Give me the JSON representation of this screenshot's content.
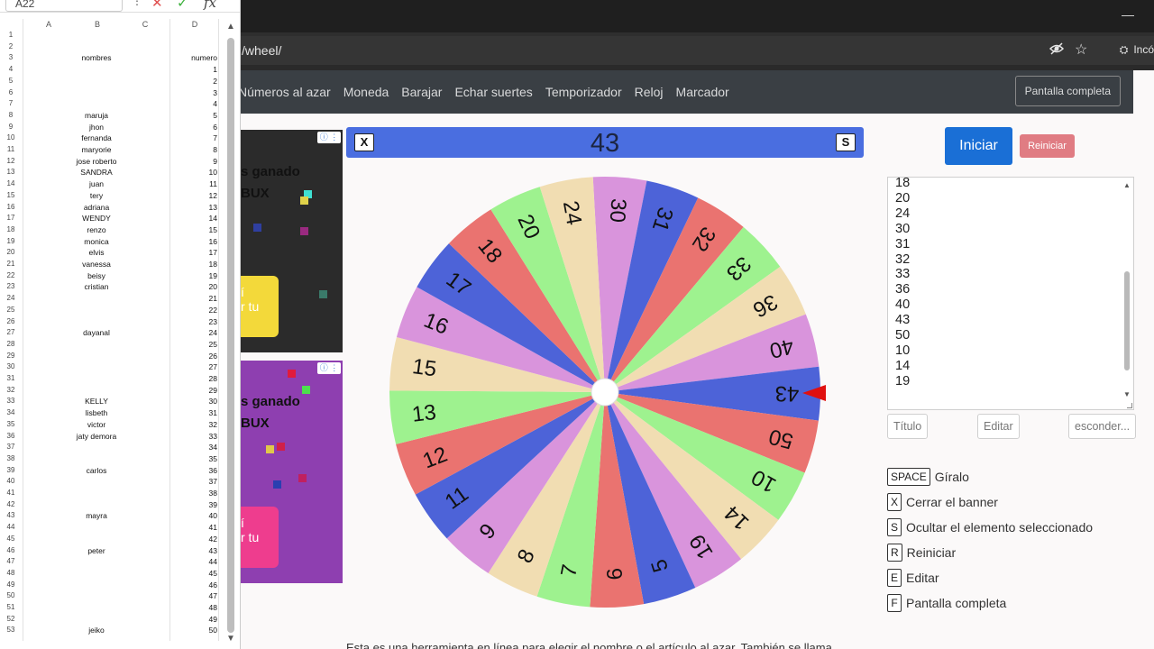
{
  "browser": {
    "url": "/wheel/",
    "incognito_label": "Incó",
    "minimize": "—"
  },
  "nav": {
    "links": [
      "Números al azar",
      "Moneda",
      "Barajar",
      "Echar suertes",
      "Temporizador",
      "Reloj",
      "Marcador"
    ],
    "fullscreen": "Pantalla completa"
  },
  "ads": {
    "ad1": {
      "line1": "s ganado",
      "line2": "BUX",
      "cta1": "í",
      "cta2": "r tu"
    },
    "ad2": {
      "line1": "s ganado",
      "line2": "BUX",
      "cta1": "í",
      "cta2": "r tu"
    },
    "info": "ⓘ ⋮"
  },
  "titlebar": {
    "close_key": "X",
    "current": "43",
    "hide_key": "S",
    "color": "#4a6ee0"
  },
  "wheel": {
    "segments": [
      "30",
      "31",
      "32",
      "33",
      "36",
      "40",
      "43",
      "50",
      "10",
      "14",
      "19",
      "5",
      "6",
      "7",
      "8",
      "9",
      "11",
      "12",
      "13",
      "15",
      "16",
      "17",
      "18",
      "20",
      "24"
    ],
    "colors": [
      "#d994dc",
      "#4d63d8",
      "#ea7370",
      "#9ef28f",
      "#f1ddb2"
    ],
    "pointer_color": "#e01010"
  },
  "controls": {
    "start": "Iniciar",
    "reset": "Reiniciar"
  },
  "entries": [
    "18",
    "20",
    "24",
    "30",
    "31",
    "32",
    "33",
    "36",
    "40",
    "43",
    "50",
    "10",
    "14",
    "19"
  ],
  "entry_buttons": {
    "title": "Título",
    "edit": "Editar",
    "hide": "esconder..."
  },
  "shortcuts": [
    {
      "key": "SPACE",
      "label": "Gíralo"
    },
    {
      "key": "X",
      "label": "Cerrar el banner"
    },
    {
      "key": "S",
      "label": "Ocultar el elemento seleccionado"
    },
    {
      "key": "R",
      "label": "Reiniciar"
    },
    {
      "key": "E",
      "label": "Editar"
    },
    {
      "key": "F",
      "label": "Pantalla completa"
    }
  ],
  "bottom_text": "Esta es una herramienta en línea para elegir el nombre o el artículo al azar. También se llama",
  "sheet": {
    "cell_ref": "A22",
    "columns": [
      "A",
      "B",
      "C",
      "D"
    ],
    "rows": [
      [
        "1",
        "",
        ""
      ],
      [
        "2",
        "",
        ""
      ],
      [
        "3",
        "nombres",
        "numero"
      ],
      [
        "4",
        "",
        "1"
      ],
      [
        "5",
        "",
        "2"
      ],
      [
        "6",
        "",
        "3"
      ],
      [
        "7",
        "",
        "4"
      ],
      [
        "8",
        "maruja",
        "5"
      ],
      [
        "9",
        "jhon",
        "6"
      ],
      [
        "10",
        "fernanda",
        "7"
      ],
      [
        "11",
        "maryorie",
        "8"
      ],
      [
        "12",
        "jose roberto",
        "9"
      ],
      [
        "13",
        "SANDRA",
        "10"
      ],
      [
        "14",
        "juan",
        "11"
      ],
      [
        "15",
        "tery",
        "12"
      ],
      [
        "16",
        "adriana",
        "13"
      ],
      [
        "17",
        "WENDY",
        "14"
      ],
      [
        "18",
        "renzo",
        "15"
      ],
      [
        "19",
        "monica",
        "16"
      ],
      [
        "20",
        "elvis",
        "17"
      ],
      [
        "21",
        "vanessa",
        "18"
      ],
      [
        "22",
        "beisy",
        "19"
      ],
      [
        "23",
        "cristian",
        "20"
      ],
      [
        "24",
        "",
        "21"
      ],
      [
        "25",
        "",
        "22"
      ],
      [
        "26",
        "",
        "23"
      ],
      [
        "27",
        "dayanal",
        "24"
      ],
      [
        "28",
        "",
        "25"
      ],
      [
        "29",
        "",
        "26"
      ],
      [
        "30",
        "",
        "27"
      ],
      [
        "31",
        "",
        "28"
      ],
      [
        "32",
        "",
        "29"
      ],
      [
        "33",
        "KELLY",
        "30"
      ],
      [
        "34",
        "lisbeth",
        "31"
      ],
      [
        "35",
        "victor",
        "32"
      ],
      [
        "36",
        "jaty demora",
        "33"
      ],
      [
        "37",
        "",
        "34"
      ],
      [
        "38",
        "",
        "35"
      ],
      [
        "39",
        "carlos",
        "36"
      ],
      [
        "40",
        "",
        "37"
      ],
      [
        "41",
        "",
        "38"
      ],
      [
        "42",
        "",
        "39"
      ],
      [
        "43",
        "mayra",
        "40"
      ],
      [
        "44",
        "",
        "41"
      ],
      [
        "45",
        "",
        "42"
      ],
      [
        "46",
        "peter",
        "43"
      ],
      [
        "47",
        "",
        "44"
      ],
      [
        "48",
        "",
        "45"
      ],
      [
        "49",
        "",
        "46"
      ],
      [
        "50",
        "",
        "47"
      ],
      [
        "51",
        "",
        "48"
      ],
      [
        "52",
        "",
        "49"
      ],
      [
        "53",
        "jeiko",
        "50"
      ]
    ]
  }
}
